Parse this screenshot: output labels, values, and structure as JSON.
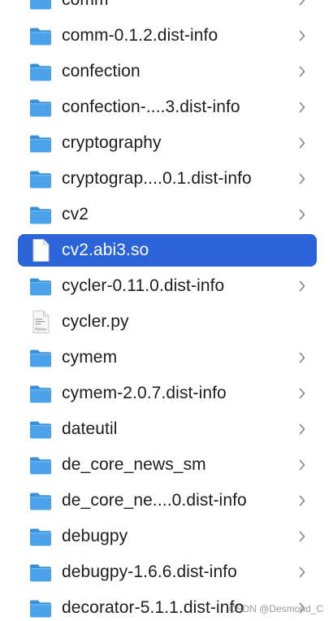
{
  "colors": {
    "folder_fill": "#4aa3ea",
    "folder_tab": "#3b8fd6",
    "selection": "#2a64d8",
    "chevron": "#8e8e93",
    "text": "#1d1d1f"
  },
  "rows": [
    {
      "name": "comm",
      "kind": "folder",
      "icon": "folder-icon",
      "has_chevron": true,
      "selected": false
    },
    {
      "name": "comm-0.1.2.dist-info",
      "kind": "folder",
      "icon": "folder-icon",
      "has_chevron": true,
      "selected": false
    },
    {
      "name": "confection",
      "kind": "folder",
      "icon": "folder-icon",
      "has_chevron": true,
      "selected": false
    },
    {
      "name": "confection-....3.dist-info",
      "kind": "folder",
      "icon": "folder-icon",
      "has_chevron": true,
      "selected": false
    },
    {
      "name": "cryptography",
      "kind": "folder",
      "icon": "folder-icon",
      "has_chevron": true,
      "selected": false
    },
    {
      "name": "cryptograp....0.1.dist-info",
      "kind": "folder",
      "icon": "folder-icon",
      "has_chevron": true,
      "selected": false
    },
    {
      "name": "cv2",
      "kind": "folder",
      "icon": "folder-icon",
      "has_chevron": true,
      "selected": false
    },
    {
      "name": "cv2.abi3.so",
      "kind": "document",
      "icon": "document-icon",
      "has_chevron": false,
      "selected": true
    },
    {
      "name": "cycler-0.11.0.dist-info",
      "kind": "folder",
      "icon": "folder-icon",
      "has_chevron": true,
      "selected": false
    },
    {
      "name": "cycler.py",
      "kind": "python",
      "icon": "python-file-icon",
      "has_chevron": false,
      "selected": false
    },
    {
      "name": "cymem",
      "kind": "folder",
      "icon": "folder-icon",
      "has_chevron": true,
      "selected": false
    },
    {
      "name": "cymem-2.0.7.dist-info",
      "kind": "folder",
      "icon": "folder-icon",
      "has_chevron": true,
      "selected": false
    },
    {
      "name": "dateutil",
      "kind": "folder",
      "icon": "folder-icon",
      "has_chevron": true,
      "selected": false
    },
    {
      "name": "de_core_news_sm",
      "kind": "folder",
      "icon": "folder-icon",
      "has_chevron": true,
      "selected": false
    },
    {
      "name": "de_core_ne....0.dist-info",
      "kind": "folder",
      "icon": "folder-icon",
      "has_chevron": true,
      "selected": false
    },
    {
      "name": "debugpy",
      "kind": "folder",
      "icon": "folder-icon",
      "has_chevron": true,
      "selected": false
    },
    {
      "name": "debugpy-1.6.6.dist-info",
      "kind": "folder",
      "icon": "folder-icon",
      "has_chevron": true,
      "selected": false
    },
    {
      "name": "decorator-5.1.1.dist-info",
      "kind": "folder",
      "icon": "folder-icon",
      "has_chevron": true,
      "selected": false
    }
  ],
  "python_icon_label": "Python",
  "watermark": "CSDN @Desmond_C"
}
